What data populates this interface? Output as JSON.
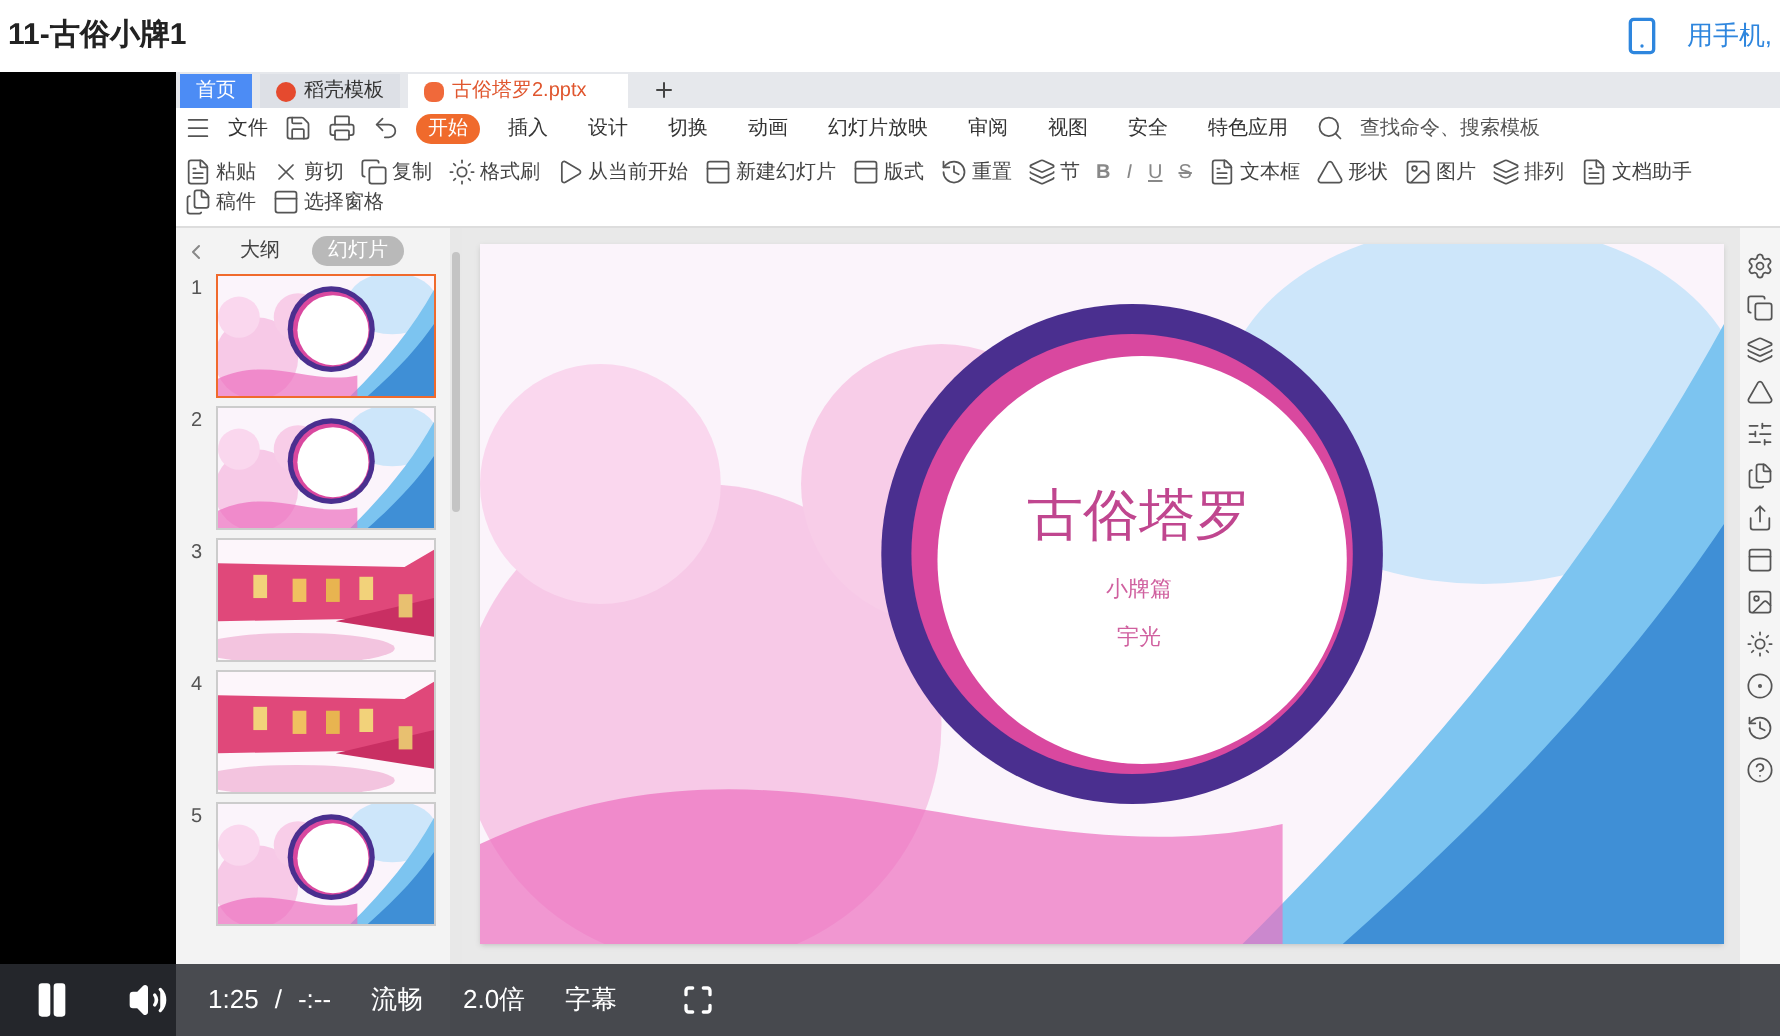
{
  "page_title": "11-古俗小牌1",
  "phone_link": "用手机,",
  "app": {
    "tabs": [
      {
        "label": "首页",
        "kind": "home",
        "selected": false
      },
      {
        "label": "稻壳模板",
        "kind": "template",
        "selected": false
      },
      {
        "label": "古俗塔罗2.pptx",
        "kind": "file",
        "selected": true
      }
    ],
    "menu": {
      "file": "文件",
      "items": [
        {
          "label": "开始",
          "selected": true
        },
        {
          "label": "插入",
          "selected": false
        },
        {
          "label": "设计",
          "selected": false
        },
        {
          "label": "切换",
          "selected": false
        },
        {
          "label": "动画",
          "selected": false
        },
        {
          "label": "幻灯片放映",
          "selected": false
        },
        {
          "label": "审阅",
          "selected": false
        },
        {
          "label": "视图",
          "selected": false
        },
        {
          "label": "安全",
          "selected": false
        },
        {
          "label": "特色应用",
          "selected": false
        }
      ],
      "search": "查找命令、搜索模板"
    },
    "ribbon": [
      {
        "label": "粘贴"
      },
      {
        "label": "剪切"
      },
      {
        "label": "复制"
      },
      {
        "label": "格式刷"
      },
      {
        "label": "从当前开始"
      },
      {
        "label": "新建幻灯片"
      },
      {
        "label": "版式"
      },
      {
        "label": "重置"
      },
      {
        "label": "节"
      },
      {
        "label": "文本框"
      },
      {
        "label": "形状"
      },
      {
        "label": "图片"
      },
      {
        "label": "排列"
      },
      {
        "label": "文档助手"
      },
      {
        "label": "稿件"
      },
      {
        "label": "选择窗格"
      }
    ],
    "format_buttons": [
      "B",
      "I",
      "U",
      "S"
    ],
    "panel": {
      "tabs": [
        {
          "label": "大纲",
          "selected": false
        },
        {
          "label": "幻灯片",
          "selected": true
        }
      ],
      "slides": [
        {
          "number": "1",
          "kind": "ring",
          "selected": true
        },
        {
          "number": "2",
          "kind": "ring",
          "selected": false
        },
        {
          "number": "3",
          "kind": "band",
          "selected": false
        },
        {
          "number": "4",
          "kind": "band",
          "selected": false
        },
        {
          "number": "5",
          "kind": "ring",
          "selected": false
        }
      ]
    },
    "slide": {
      "title": "古俗塔罗",
      "subtitle": "小牌篇",
      "author": "宇光"
    }
  },
  "player": {
    "playing": true,
    "time": "1:25",
    "separator": "/",
    "duration": "-:--",
    "quality": "流畅",
    "speed": "2.0倍",
    "subtitles": "字幕"
  }
}
